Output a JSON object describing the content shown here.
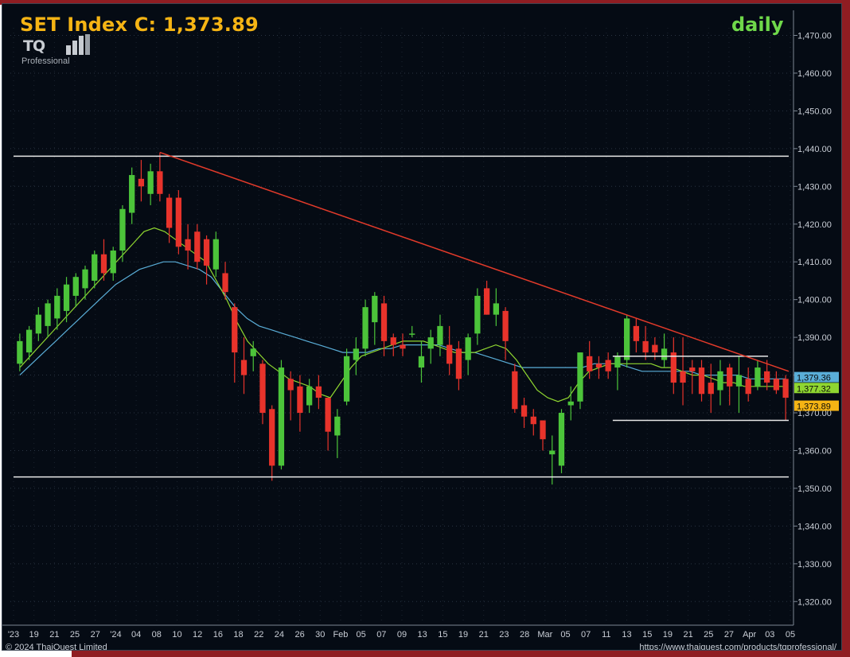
{
  "header": {
    "title": "SET Index C: 1,373.89",
    "period": "daily",
    "logo_text": "TQ",
    "logo_sub": "Professional"
  },
  "footer": {
    "copyright": "© 2024 ThaiQuest Limited",
    "url": "https://www.thaiquest.com/products/tqprofessional/"
  },
  "colors": {
    "background": "#050b14",
    "up": "#4cc43a",
    "down": "#e8332b",
    "ma_fast": "#8fd630",
    "ma_slow": "#5aaed8",
    "trendline": "#e23a2a",
    "level_line": "#e8e8e8",
    "title": "#f5b414",
    "period": "#6fd84a"
  },
  "chart_data": {
    "type": "candlestick",
    "y_axis_ticks": [
      "1,470.00",
      "1,460.00",
      "1,450.00",
      "1,440.00",
      "1,430.00",
      "1,420.00",
      "1,410.00",
      "1,400.00",
      "1,390.00",
      "1,380.00",
      "1,370.00",
      "1,360.00",
      "1,350.00",
      "1,340.00",
      "1,330.00",
      "1,320.00"
    ],
    "ylim": [
      1315,
      1472
    ],
    "x_axis_labels": [
      "'23",
      "19",
      "21",
      "25",
      "27",
      "'24",
      "04",
      "08",
      "10",
      "12",
      "16",
      "18",
      "22",
      "24",
      "26",
      "30",
      "Feb",
      "05",
      "07",
      "09",
      "13",
      "15",
      "19",
      "21",
      "23",
      "28",
      "Mar",
      "05",
      "07",
      "11",
      "13",
      "15",
      "19",
      "21",
      "25",
      "27",
      "Apr",
      "03",
      "05"
    ],
    "price_tags": [
      {
        "label": "1,379.36",
        "value": 1379.36,
        "color": "#5aaed8"
      },
      {
        "label": "1,377.32",
        "value": 1377.32,
        "color": "#8fd630"
      },
      {
        "label": "1,373.89",
        "value": 1373.89,
        "color": "#f5b414"
      }
    ],
    "candles": [
      [
        1383,
        1391,
        1381,
        1389
      ],
      [
        1386,
        1393,
        1384,
        1392
      ],
      [
        1391,
        1398,
        1389,
        1396
      ],
      [
        1393,
        1400,
        1390,
        1399
      ],
      [
        1395,
        1403,
        1392,
        1401
      ],
      [
        1397,
        1406,
        1394,
        1404
      ],
      [
        1401,
        1407,
        1398,
        1406
      ],
      [
        1403,
        1409,
        1400,
        1408
      ],
      [
        1405,
        1413,
        1403,
        1412
      ],
      [
        1412,
        1416,
        1405,
        1407
      ],
      [
        1407,
        1414,
        1405,
        1413
      ],
      [
        1413,
        1425,
        1410,
        1424
      ],
      [
        1423,
        1435,
        1420,
        1433
      ],
      [
        1432,
        1437,
        1426,
        1430
      ],
      [
        1428,
        1436,
        1425,
        1434
      ],
      [
        1434,
        1439,
        1426,
        1428
      ],
      [
        1427,
        1428,
        1415,
        1419
      ],
      [
        1427,
        1429,
        1412,
        1414
      ],
      [
        1416,
        1420,
        1408,
        1413
      ],
      [
        1418,
        1420,
        1408,
        1410
      ],
      [
        1416,
        1417,
        1404,
        1409
      ],
      [
        1408,
        1418,
        1406,
        1416
      ],
      [
        1407,
        1410,
        1400,
        1402
      ],
      [
        1398,
        1399,
        1378,
        1386
      ],
      [
        1384,
        1390,
        1375,
        1380
      ],
      [
        1385,
        1389,
        1381,
        1387
      ],
      [
        1383,
        1384,
        1367,
        1370
      ],
      [
        1371,
        1372,
        1352,
        1356
      ],
      [
        1356,
        1384,
        1355,
        1382
      ],
      [
        1379,
        1381,
        1368,
        1376
      ],
      [
        1377,
        1380,
        1365,
        1370
      ],
      [
        1372,
        1379,
        1370,
        1377
      ],
      [
        1377,
        1380,
        1371,
        1374
      ],
      [
        1374,
        1374,
        1360,
        1365
      ],
      [
        1364,
        1371,
        1358,
        1369
      ],
      [
        1373,
        1387,
        1372,
        1385
      ],
      [
        1384,
        1390,
        1380,
        1387
      ],
      [
        1387,
        1400,
        1385,
        1398
      ],
      [
        1394,
        1402,
        1388,
        1401
      ],
      [
        1399,
        1401,
        1385,
        1389
      ],
      [
        1390,
        1391,
        1385,
        1388
      ],
      [
        1388,
        1391,
        1385,
        1387
      ],
      [
        1391,
        1393,
        1390,
        1391
      ],
      [
        1382,
        1389,
        1378,
        1385
      ],
      [
        1387,
        1392,
        1383,
        1390
      ],
      [
        1388,
        1396,
        1385,
        1393
      ],
      [
        1388,
        1393,
        1380,
        1383
      ],
      [
        1387,
        1389,
        1376,
        1379
      ],
      [
        1384,
        1391,
        1380,
        1390
      ],
      [
        1391,
        1403,
        1388,
        1401
      ],
      [
        1403,
        1405,
        1396,
        1396
      ],
      [
        1396,
        1403,
        1393,
        1399
      ],
      [
        1397,
        1398,
        1384,
        1389
      ],
      [
        1381,
        1383,
        1370,
        1371
      ],
      [
        1372,
        1374,
        1366,
        1369
      ],
      [
        1369,
        1371,
        1364,
        1367
      ],
      [
        1368,
        1368,
        1360,
        1363
      ],
      [
        1359,
        1364,
        1351,
        1360
      ],
      [
        1356,
        1371,
        1354,
        1370
      ],
      [
        1372,
        1377,
        1368,
        1373
      ],
      [
        1373,
        1386,
        1371,
        1386
      ],
      [
        1385,
        1389,
        1379,
        1381
      ],
      [
        1383,
        1385,
        1379,
        1382
      ],
      [
        1384,
        1386,
        1379,
        1381
      ],
      [
        1382,
        1386,
        1376,
        1385
      ],
      [
        1384,
        1396,
        1382,
        1395
      ],
      [
        1393,
        1395,
        1386,
        1389
      ],
      [
        1389,
        1393,
        1384,
        1386
      ],
      [
        1388,
        1390,
        1384,
        1386
      ],
      [
        1384,
        1391,
        1382,
        1387
      ],
      [
        1386,
        1390,
        1375,
        1378
      ],
      [
        1381,
        1390,
        1372,
        1378
      ],
      [
        1382,
        1384,
        1375,
        1381
      ],
      [
        1382,
        1384,
        1373,
        1375
      ],
      [
        1378,
        1383,
        1370,
        1375
      ],
      [
        1376,
        1384,
        1372,
        1381
      ],
      [
        1382,
        1383,
        1372,
        1377
      ],
      [
        1377,
        1385,
        1370,
        1380
      ],
      [
        1379,
        1382,
        1373,
        1375
      ],
      [
        1377,
        1384,
        1376,
        1382
      ],
      [
        1381,
        1384,
        1376,
        1378
      ],
      [
        1379,
        1381,
        1375,
        1376
      ],
      [
        1379,
        1380,
        1368,
        1374
      ]
    ],
    "ma_fast": [
      1382,
      1385,
      1388,
      1391,
      1394,
      1397,
      1400,
      1403,
      1406,
      1409,
      1412,
      1415,
      1418,
      1419,
      1418,
      1416,
      1414,
      1412,
      1410,
      1405,
      1400,
      1394,
      1389,
      1386,
      1383,
      1381,
      1379,
      1378,
      1377,
      1375,
      1374,
      1378,
      1382,
      1385,
      1386,
      1387,
      1388,
      1389,
      1389,
      1389,
      1388,
      1387,
      1386,
      1386,
      1386,
      1387,
      1388,
      1387,
      1384,
      1380,
      1376,
      1374,
      1373,
      1374,
      1378,
      1381,
      1382,
      1383,
      1383,
      1383,
      1383,
      1383,
      1382,
      1382,
      1381,
      1380,
      1380,
      1379,
      1378,
      1378,
      1377,
      1377,
      1377,
      1377,
      1377
    ],
    "ma_slow": [
      1380,
      1383,
      1386,
      1389,
      1392,
      1395,
      1398,
      1401,
      1404,
      1406,
      1408,
      1409,
      1410,
      1410,
      1409,
      1408,
      1406,
      1402,
      1398,
      1395,
      1393,
      1392,
      1391,
      1390,
      1389,
      1388,
      1387,
      1386,
      1386,
      1386,
      1387,
      1387,
      1388,
      1388,
      1388,
      1388,
      1387,
      1386,
      1386,
      1385,
      1384,
      1383,
      1382,
      1382,
      1382,
      1382,
      1382,
      1382,
      1383,
      1383,
      1383,
      1382,
      1381,
      1381,
      1381,
      1381,
      1381,
      1380,
      1380,
      1380,
      1380,
      1379,
      1379,
      1379,
      1379
    ],
    "horizontal_levels": [
      1438,
      1353,
      1385,
      1368
    ],
    "trendline": {
      "from_value": 1439,
      "to_value": 1381
    }
  }
}
